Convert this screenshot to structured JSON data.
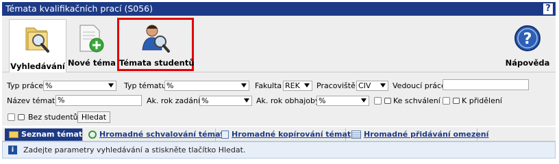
{
  "window": {
    "title": "Témata kvalifikačních prací (S056)",
    "help_glyph": "?"
  },
  "toolbar": {
    "search_label": "Vyhledávání",
    "new_topic_label": "Nové téma",
    "student_topics_label": "Témata studentů",
    "help_label": "Nápověda"
  },
  "filters": {
    "type_label": "Typ práce",
    "type_value": "%",
    "topic_type_label": "Typ tématu",
    "topic_type_value": "%",
    "faculty_label": "Fakulta",
    "faculty_value": "REK",
    "workplace_label": "Pracoviště",
    "workplace_value": "CIV",
    "supervisor_label": "Vedoucí práce",
    "supervisor_value": "",
    "name_label": "Název tématu",
    "name_value": "%",
    "year_assign_label": "Ak. rok zadání",
    "year_assign_value": "%",
    "year_defense_label": "Ak. rok obhajoby",
    "year_defense_value": "%",
    "to_approve_label": "Ke schválení",
    "to_assign_label": "K přidělení",
    "no_students_label": "Bez studentů",
    "search_button": "Hledat"
  },
  "tabs": [
    {
      "label": "Seznam témat"
    },
    {
      "label": "Hromadné schvalování témat"
    },
    {
      "label": "Hromadné kopírování témat"
    },
    {
      "label": "Hromadné přidávání omezení"
    }
  ],
  "info": {
    "icon": "i",
    "text": "Zadejte parametry vyhledávání a stiskněte tlačítko Hledat."
  },
  "colors": {
    "title_bg": "#1d3a86",
    "highlight": "#e00000",
    "panel_bg": "#eeeeee",
    "info_bg": "#e7eef8"
  }
}
